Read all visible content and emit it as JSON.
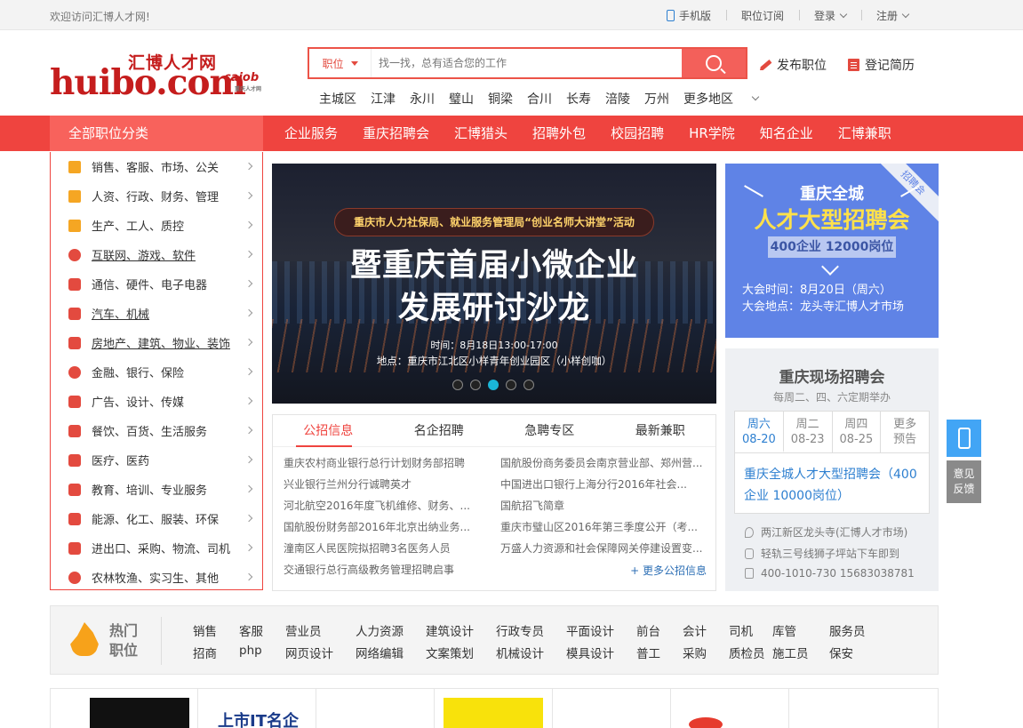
{
  "topbar": {
    "welcome": "欢迎访问汇博人才网!",
    "mobile": "手机版",
    "subscribe": "职位订阅",
    "login": "登录",
    "register": "注册"
  },
  "logo": {
    "cn": "汇博人才网",
    "en": "huibo.com",
    "cajob": "cajob",
    "cajob_sub": "重庆人才网"
  },
  "search": {
    "type": "职位",
    "placeholder": "找一找，总有适合您的工作"
  },
  "header_links": {
    "post_job": "发布职位",
    "post_resume": "登记简历"
  },
  "areas": [
    "主城区",
    "江津",
    "永川",
    "璧山",
    "铜梁",
    "合川",
    "长寿",
    "涪陵",
    "万州",
    "更多地区"
  ],
  "nav": {
    "all": "全部职位分类",
    "items": [
      "企业服务",
      "重庆招聘会",
      "汇博猎头",
      "招聘外包",
      "校园招聘",
      "HR学院",
      "知名企业",
      "汇博兼职"
    ]
  },
  "categories": [
    "销售、客服、市场、公关",
    "人资、行政、财务、管理",
    "生产、工人、质控",
    "互联网、游戏、软件",
    "通信、硬件、电子电器",
    "汽车、机械",
    "房地产、建筑、物业、装饰",
    "金融、银行、保险",
    "广告、设计、传媒",
    "餐饮、百货、生活服务",
    "医疗、医药",
    "教育、培训、专业服务",
    "能源、化工、服装、环保",
    "进出口、采购、物流、司机",
    "农林牧渔、实习生、其他"
  ],
  "banner": {
    "pill": "重庆市人力社保局、就业服务管理局“创业名师大讲堂”活动",
    "line1": "暨重庆首届小微企业",
    "line2": "发展研讨沙龙",
    "time": "时间：8月18日13:00-17:00",
    "place": "地点：重庆市江北区小样青年创业园区（小样创咖）",
    "active_dot": 3
  },
  "ad": {
    "ribbon": "招聘会",
    "line1": "重庆全城",
    "line2": "人才大型招聘会",
    "line3": "400企业 12000岗位",
    "time": "大会时间：8月20日（周六）",
    "place": "大会地点：龙头寺汇博人才市场"
  },
  "news": {
    "tabs": [
      "公招信息",
      "名企招聘",
      "急聘专区",
      "最新兼职"
    ],
    "left": [
      "重庆农村商业银行总行计划财务部招聘",
      "兴业银行兰州分行诚聘英才",
      "河北航空2016年度飞机维修、财务、...",
      "国航股份财务部2016年北京出纳业务...",
      "潼南区人民医院拟招聘3名医务人员",
      "交通银行总行高级教务管理招聘启事"
    ],
    "right": [
      "国航股份商务委员会南京营业部、郑州营...",
      "中国进出口银行上海分行2016年社会...",
      "国航招飞简章",
      "重庆市璧山区2016年第三季度公开（考...",
      "万盛人力资源和社会保障网关停建设置变..."
    ],
    "more": "+ 更多公招信息"
  },
  "fair": {
    "title": "重庆现场招聘会",
    "subtitle": "每周二、四、六定期举办",
    "days": [
      {
        "d": "周六",
        "date": "08-20"
      },
      {
        "d": "周二",
        "date": "08-23"
      },
      {
        "d": "周四",
        "date": "08-25"
      },
      {
        "d": "更多",
        "date": "预告"
      }
    ],
    "event": "重庆全城人才大型招聘会（400企业 10000岗位）",
    "address": "两江新区龙头寺(汇博人才市场)",
    "transit": "轻轨三号线狮子坪站下车即到",
    "phone": "400-1010-730 15683038781"
  },
  "side": {
    "feedback1": "意见",
    "feedback2": "反馈"
  },
  "hot": {
    "label1": "热门",
    "label2": "职位",
    "row1": [
      "销售",
      "客服",
      "营业员",
      "人力资源",
      "建筑设计",
      "行政专员",
      "平面设计",
      "前台",
      "会计",
      "司机",
      "库管",
      "服务员"
    ],
    "row2": [
      "招商",
      "php",
      "网页设计",
      "网络编辑",
      "文案策划",
      "机械设计",
      "模具设计",
      "普工",
      "采购",
      "质检员",
      "施工员",
      "保安"
    ]
  },
  "logos": {
    "it": "上市IT名企"
  }
}
